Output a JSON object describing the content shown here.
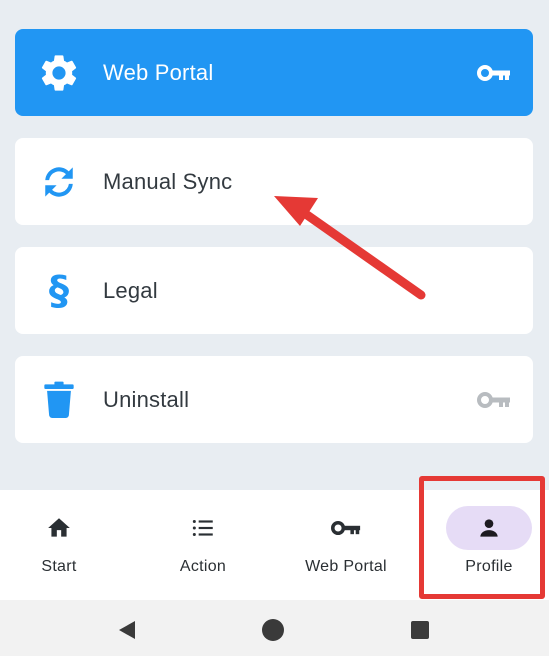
{
  "menu": {
    "items": [
      {
        "label": "Web Portal",
        "icon": "gear-icon",
        "trailing_icon": "key-icon",
        "active": true
      },
      {
        "label": "Manual Sync",
        "icon": "sync-icon"
      },
      {
        "label": "Legal",
        "icon": "section-icon"
      },
      {
        "label": "Uninstall",
        "icon": "trash-icon",
        "trailing_icon": "key-icon"
      }
    ]
  },
  "bottom_nav": {
    "items": [
      {
        "label": "Start",
        "icon": "home-icon"
      },
      {
        "label": "Action",
        "icon": "list-icon"
      },
      {
        "label": "Web Portal",
        "icon": "key-icon"
      },
      {
        "label": "Profile",
        "icon": "person-icon",
        "selected": true
      }
    ]
  },
  "system_nav": {
    "buttons": [
      "back-icon",
      "home-circle-icon",
      "recents-icon"
    ]
  },
  "colors": {
    "accent": "#2196f3",
    "annotation": "#e53935",
    "selected_pill": "#e6dcf6",
    "background": "#e8edf2"
  }
}
